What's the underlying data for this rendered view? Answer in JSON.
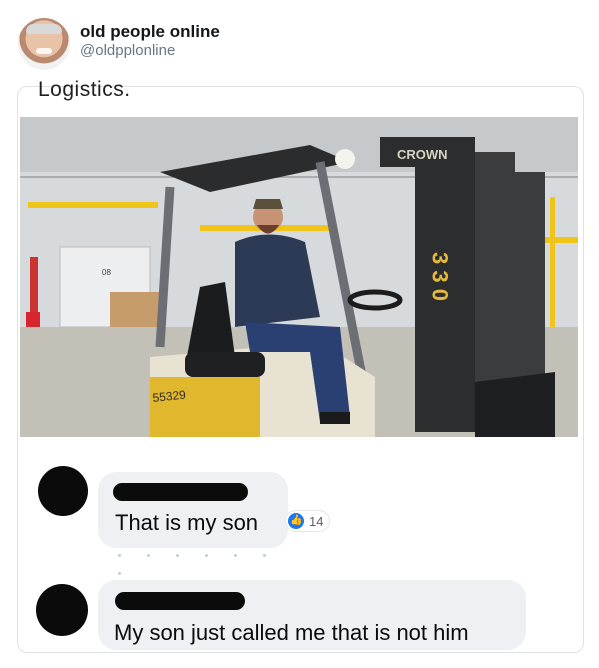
{
  "tweet": {
    "display_name": "old people online",
    "handle": "@oldpplonline"
  },
  "post": {
    "cut_text": "Logistics."
  },
  "photo": {
    "forklift_brand": "CROWN",
    "forklift_number": "3 3 0",
    "forklift_id": "55329",
    "door_label": "08"
  },
  "comments": [
    {
      "text": "That is my son",
      "reaction_count": "14"
    },
    {
      "text": "My son just called me that is not him"
    }
  ]
}
